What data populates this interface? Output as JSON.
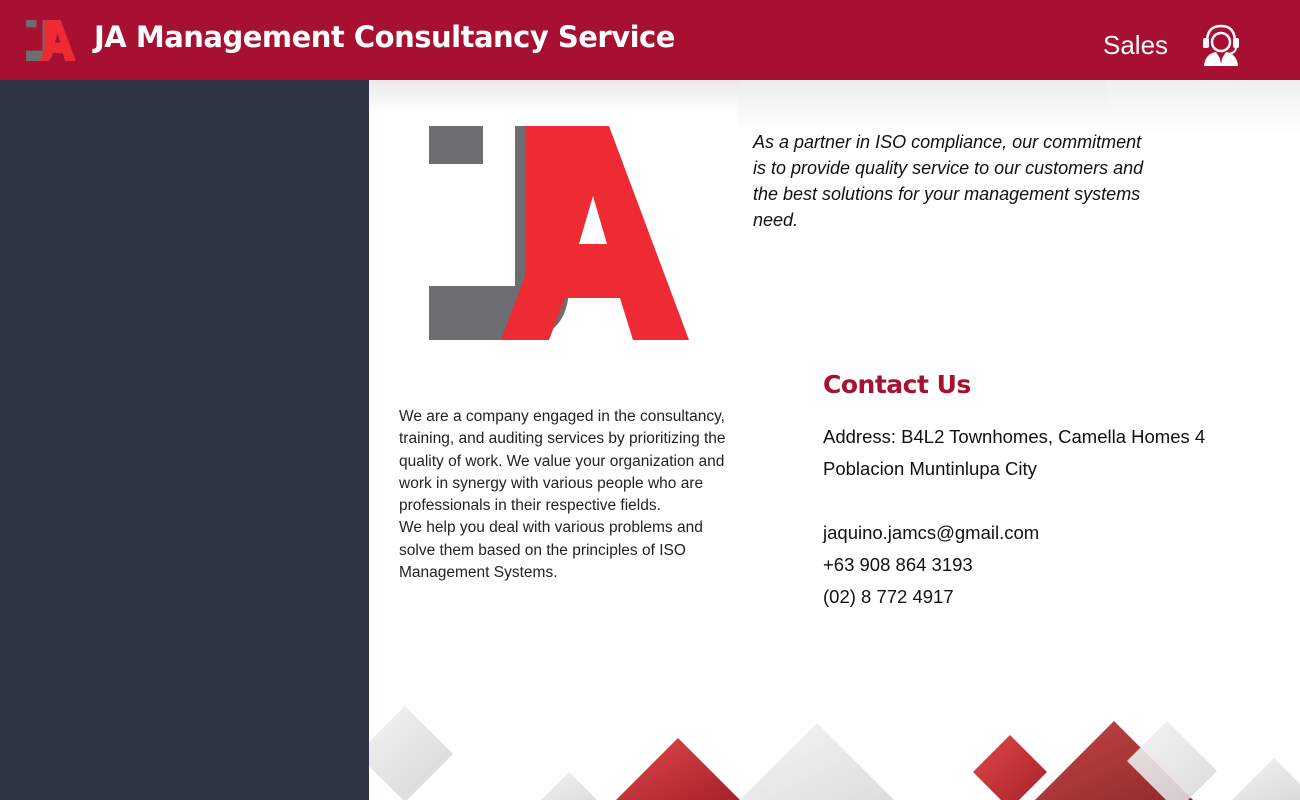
{
  "header": {
    "title": "JA Management Consultancy Service",
    "sales_label": "Sales",
    "logo_icon": "ja-logo",
    "support_icon": "customer-support-headset-icon"
  },
  "colors": {
    "brand": "#a71030",
    "sidebar": "#2f3541",
    "logo_gray": "#6d6e72",
    "logo_red": "#ee2a33"
  },
  "main": {
    "tagline": "As a partner in ISO compliance, our commitment is to provide quality service to our customers and the best solutions for your management systems need.",
    "about": [
      "We are a company engaged in the consultancy, training, and auditing services by prioritizing the quality of work. We value your organization and work in synergy with various people who are professionals in their respective fields.",
      "We help you deal with various problems and solve them based on the principles of ISO Management Systems."
    ],
    "contact": {
      "heading": "Contact Us",
      "address": "Address: B4L2 Townhomes, Camella Homes 4 Poblacion Muntinlupa City",
      "email": "jaquino.jamcs@gmail.com",
      "mobile": "+63 908 864 3193",
      "landline": "(02) 8 772 4917"
    }
  }
}
